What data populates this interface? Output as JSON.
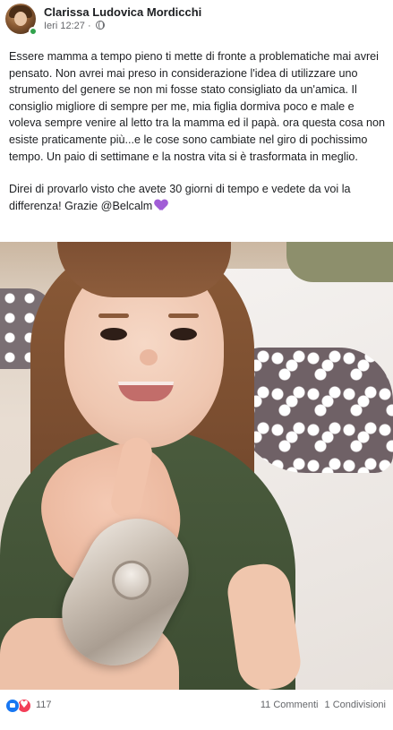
{
  "post": {
    "author": "Clarissa Ludovica Mordicchi",
    "time": "Ieri 12:27",
    "separator": "·",
    "privacy_icon": "globe-icon",
    "paragraphs": [
      "Essere mamma a tempo pieno ti mette di fronte a problematiche mai avrei pensato. Non avrei mai preso in considerazione l'idea di utilizzare uno strumento del genere se non mi fosse stato consigliato da un'amica. Il consiglio migliore di sempre per me, mia figlia dormiva poco e male e voleva sempre venire al letto tra la mamma ed il papà. ora questa cosa non esiste praticamente più...e le cose sono cambiate nel giro di pochissimo tempo. Un paio di settimane e la nostra vita si è trasformata in meglio.",
      "Direi di provarlo visto che avete 30 giorni di tempo e vedete da voi la differenza! Grazie @Belcalm"
    ],
    "emoji": "purple-heart-icon"
  },
  "footer": {
    "reaction_icons": [
      "like-icon",
      "love-icon"
    ],
    "reaction_count": "117",
    "comments": "11 Commenti",
    "shares": "1 Condivisioni"
  },
  "colors": {
    "link_blue": "#1877f2",
    "love_red": "#f33e58",
    "online_green": "#31a24c",
    "meta_gray": "#65676b"
  }
}
